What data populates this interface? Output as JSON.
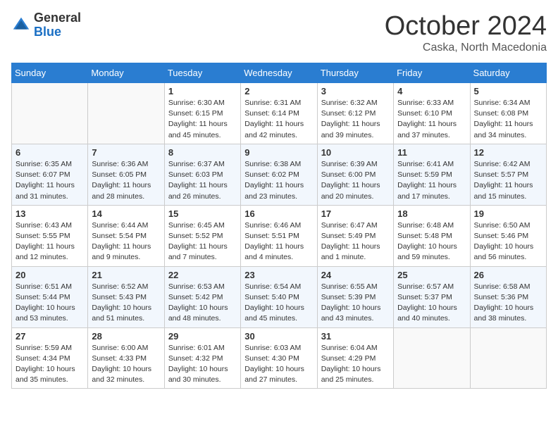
{
  "header": {
    "logo_general": "General",
    "logo_blue": "Blue",
    "month": "October 2024",
    "location": "Caska, North Macedonia"
  },
  "weekdays": [
    "Sunday",
    "Monday",
    "Tuesday",
    "Wednesday",
    "Thursday",
    "Friday",
    "Saturday"
  ],
  "weeks": [
    [
      {
        "day": "",
        "info": ""
      },
      {
        "day": "",
        "info": ""
      },
      {
        "day": "1",
        "info": "Sunrise: 6:30 AM\nSunset: 6:15 PM\nDaylight: 11 hours and 45 minutes."
      },
      {
        "day": "2",
        "info": "Sunrise: 6:31 AM\nSunset: 6:14 PM\nDaylight: 11 hours and 42 minutes."
      },
      {
        "day": "3",
        "info": "Sunrise: 6:32 AM\nSunset: 6:12 PM\nDaylight: 11 hours and 39 minutes."
      },
      {
        "day": "4",
        "info": "Sunrise: 6:33 AM\nSunset: 6:10 PM\nDaylight: 11 hours and 37 minutes."
      },
      {
        "day": "5",
        "info": "Sunrise: 6:34 AM\nSunset: 6:08 PM\nDaylight: 11 hours and 34 minutes."
      }
    ],
    [
      {
        "day": "6",
        "info": "Sunrise: 6:35 AM\nSunset: 6:07 PM\nDaylight: 11 hours and 31 minutes."
      },
      {
        "day": "7",
        "info": "Sunrise: 6:36 AM\nSunset: 6:05 PM\nDaylight: 11 hours and 28 minutes."
      },
      {
        "day": "8",
        "info": "Sunrise: 6:37 AM\nSunset: 6:03 PM\nDaylight: 11 hours and 26 minutes."
      },
      {
        "day": "9",
        "info": "Sunrise: 6:38 AM\nSunset: 6:02 PM\nDaylight: 11 hours and 23 minutes."
      },
      {
        "day": "10",
        "info": "Sunrise: 6:39 AM\nSunset: 6:00 PM\nDaylight: 11 hours and 20 minutes."
      },
      {
        "day": "11",
        "info": "Sunrise: 6:41 AM\nSunset: 5:59 PM\nDaylight: 11 hours and 17 minutes."
      },
      {
        "day": "12",
        "info": "Sunrise: 6:42 AM\nSunset: 5:57 PM\nDaylight: 11 hours and 15 minutes."
      }
    ],
    [
      {
        "day": "13",
        "info": "Sunrise: 6:43 AM\nSunset: 5:55 PM\nDaylight: 11 hours and 12 minutes."
      },
      {
        "day": "14",
        "info": "Sunrise: 6:44 AM\nSunset: 5:54 PM\nDaylight: 11 hours and 9 minutes."
      },
      {
        "day": "15",
        "info": "Sunrise: 6:45 AM\nSunset: 5:52 PM\nDaylight: 11 hours and 7 minutes."
      },
      {
        "day": "16",
        "info": "Sunrise: 6:46 AM\nSunset: 5:51 PM\nDaylight: 11 hours and 4 minutes."
      },
      {
        "day": "17",
        "info": "Sunrise: 6:47 AM\nSunset: 5:49 PM\nDaylight: 11 hours and 1 minute."
      },
      {
        "day": "18",
        "info": "Sunrise: 6:48 AM\nSunset: 5:48 PM\nDaylight: 10 hours and 59 minutes."
      },
      {
        "day": "19",
        "info": "Sunrise: 6:50 AM\nSunset: 5:46 PM\nDaylight: 10 hours and 56 minutes."
      }
    ],
    [
      {
        "day": "20",
        "info": "Sunrise: 6:51 AM\nSunset: 5:44 PM\nDaylight: 10 hours and 53 minutes."
      },
      {
        "day": "21",
        "info": "Sunrise: 6:52 AM\nSunset: 5:43 PM\nDaylight: 10 hours and 51 minutes."
      },
      {
        "day": "22",
        "info": "Sunrise: 6:53 AM\nSunset: 5:42 PM\nDaylight: 10 hours and 48 minutes."
      },
      {
        "day": "23",
        "info": "Sunrise: 6:54 AM\nSunset: 5:40 PM\nDaylight: 10 hours and 45 minutes."
      },
      {
        "day": "24",
        "info": "Sunrise: 6:55 AM\nSunset: 5:39 PM\nDaylight: 10 hours and 43 minutes."
      },
      {
        "day": "25",
        "info": "Sunrise: 6:57 AM\nSunset: 5:37 PM\nDaylight: 10 hours and 40 minutes."
      },
      {
        "day": "26",
        "info": "Sunrise: 6:58 AM\nSunset: 5:36 PM\nDaylight: 10 hours and 38 minutes."
      }
    ],
    [
      {
        "day": "27",
        "info": "Sunrise: 5:59 AM\nSunset: 4:34 PM\nDaylight: 10 hours and 35 minutes."
      },
      {
        "day": "28",
        "info": "Sunrise: 6:00 AM\nSunset: 4:33 PM\nDaylight: 10 hours and 32 minutes."
      },
      {
        "day": "29",
        "info": "Sunrise: 6:01 AM\nSunset: 4:32 PM\nDaylight: 10 hours and 30 minutes."
      },
      {
        "day": "30",
        "info": "Sunrise: 6:03 AM\nSunset: 4:30 PM\nDaylight: 10 hours and 27 minutes."
      },
      {
        "day": "31",
        "info": "Sunrise: 6:04 AM\nSunset: 4:29 PM\nDaylight: 10 hours and 25 minutes."
      },
      {
        "day": "",
        "info": ""
      },
      {
        "day": "",
        "info": ""
      }
    ]
  ]
}
